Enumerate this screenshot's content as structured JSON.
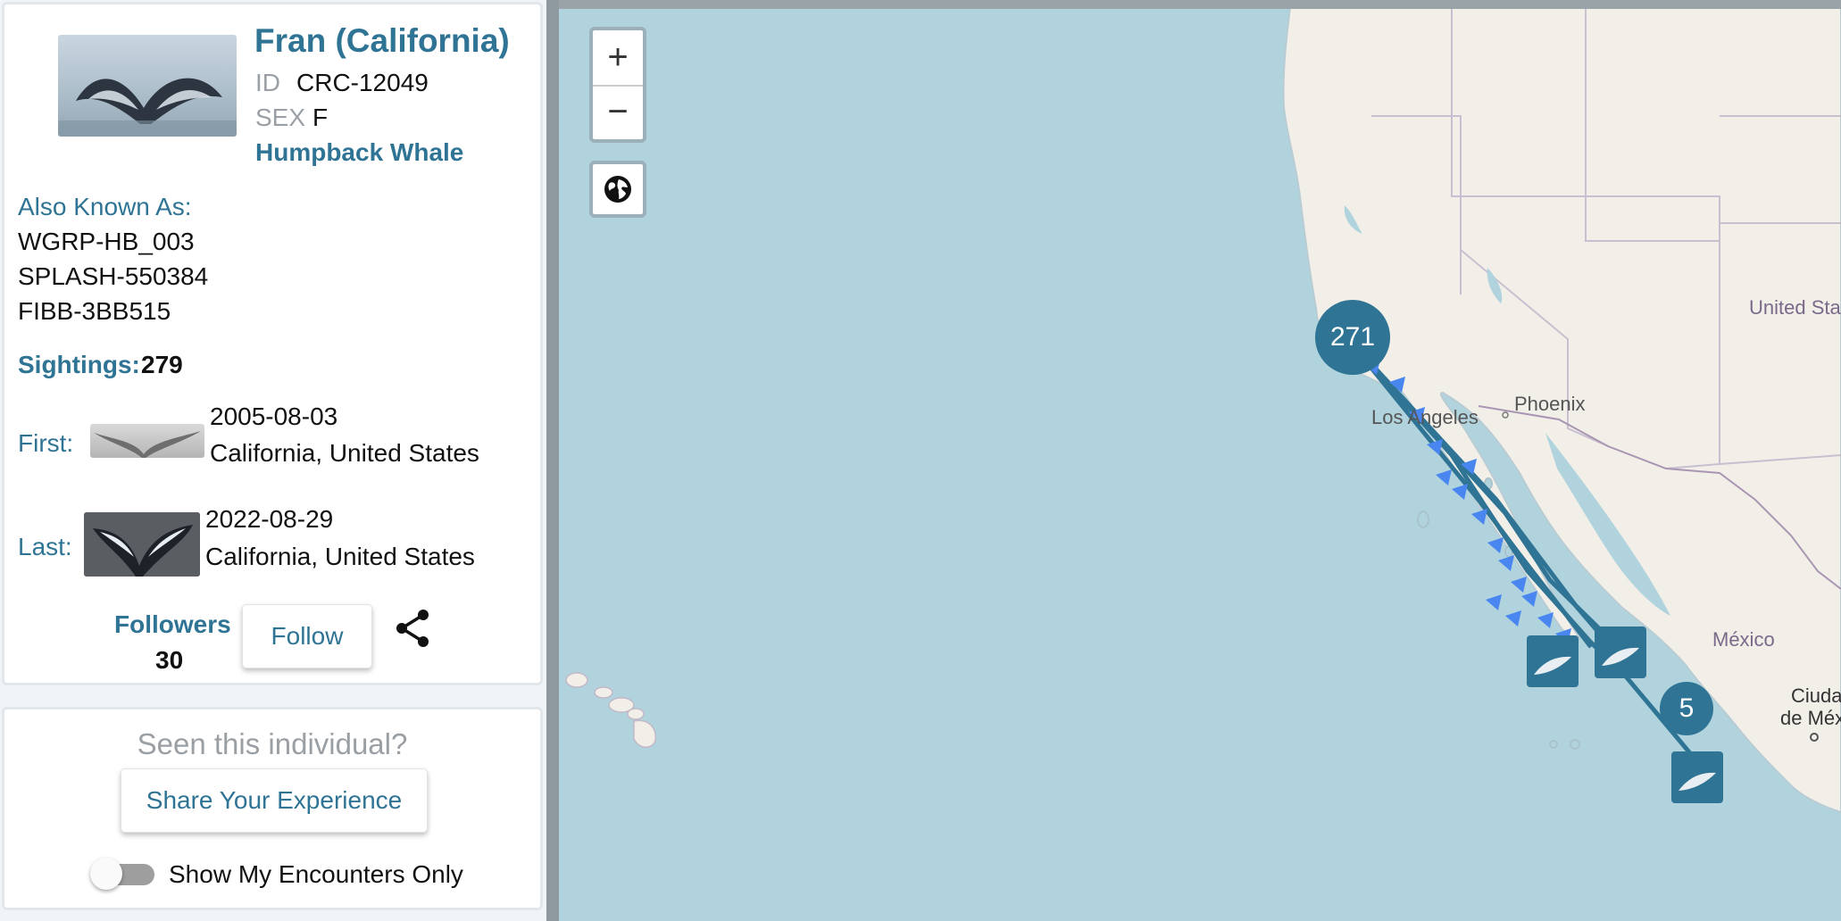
{
  "profile": {
    "name": "Fran (California)",
    "id_label": "ID",
    "id_value": "CRC-12049",
    "sex_label": "SEX",
    "sex_value": "F",
    "species": "Humpback Whale",
    "aka_label": "Also Known As:",
    "aka": [
      "WGRP-HB_003",
      "SPLASH-550384",
      "FIBB-3BB515"
    ],
    "sightings_label": "Sightings:",
    "sightings_count": "279",
    "first_label": "First:",
    "first_date": "2005-08-03",
    "first_location": "California, United States",
    "last_label": "Last:",
    "last_date": "2022-08-29",
    "last_location": "California, United States",
    "followers_label": "Followers",
    "followers_count": "30",
    "follow_button": "Follow",
    "share_icon": "share-icon"
  },
  "share_card": {
    "prompt": "Seen this individual?",
    "button": "Share Your Experience",
    "toggle_label": "Show My Encounters Only",
    "toggle_on": false
  },
  "map": {
    "zoom_in": "+",
    "zoom_out": "−",
    "globe_icon": "globe-icon",
    "labels": {
      "los_angeles": "Los Angeles",
      "phoenix": "Phoenix",
      "united_states": "United Sta",
      "mexico": "México",
      "ciudad_1": "Ciudad",
      "ciudad_2": "de Méxi"
    },
    "clusters": {
      "large": "271",
      "small": "5"
    },
    "colors": {
      "ocean": "#b1d3dd",
      "land": "#f2efe9",
      "cluster": "#2f7494",
      "marker": "#4a86f0"
    }
  }
}
